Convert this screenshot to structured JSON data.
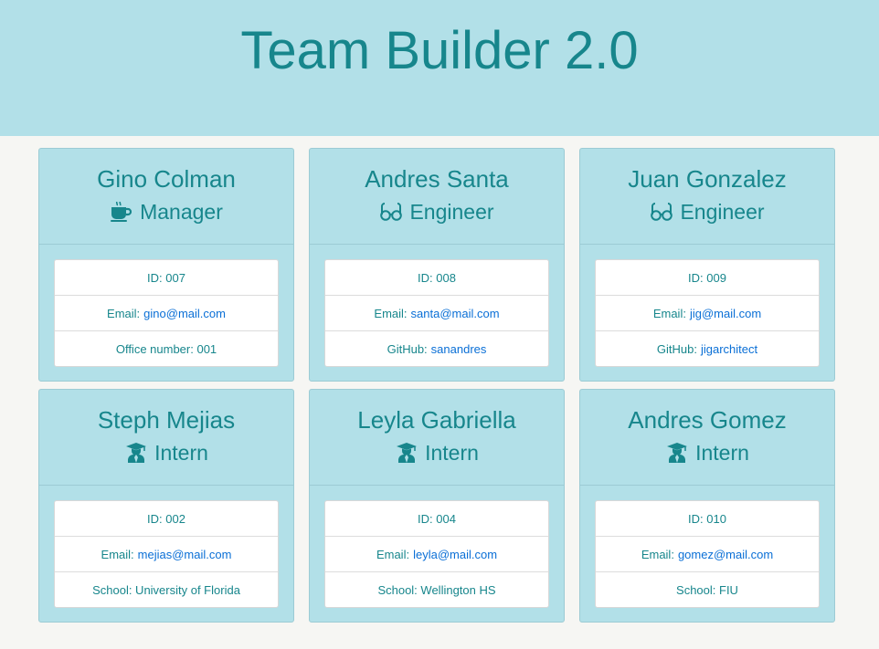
{
  "header": {
    "title": "Team Builder 2.0"
  },
  "team": [
    {
      "name": "Gino Colman",
      "role": "Manager",
      "role_icon": "coffee-mug-icon",
      "id_label": "ID: 007",
      "email_label": "Email:",
      "email": "gino@mail.com",
      "extra_label": "Office number: 001",
      "extra_link": ""
    },
    {
      "name": "Andres Santa",
      "role": "Engineer",
      "role_icon": "glasses-icon",
      "id_label": "ID: 008",
      "email_label": "Email:",
      "email": "santa@mail.com",
      "extra_label": "GitHub:",
      "extra_link": "sanandres"
    },
    {
      "name": "Juan Gonzalez",
      "role": "Engineer",
      "role_icon": "glasses-icon",
      "id_label": "ID: 009",
      "email_label": "Email:",
      "email": "jig@mail.com",
      "extra_label": "GitHub:",
      "extra_link": "jigarchitect"
    },
    {
      "name": "Steph Mejias",
      "role": "Intern",
      "role_icon": "graduate-icon",
      "id_label": "ID: 002",
      "email_label": "Email:",
      "email": "mejias@mail.com",
      "extra_label": "School: University of Florida",
      "extra_link": ""
    },
    {
      "name": "Leyla Gabriella",
      "role": "Intern",
      "role_icon": "graduate-icon",
      "id_label": "ID: 004",
      "email_label": "Email:",
      "email": "leyla@mail.com",
      "extra_label": "School: Wellington HS",
      "extra_link": ""
    },
    {
      "name": "Andres Gomez",
      "role": "Intern",
      "role_icon": "graduate-icon",
      "id_label": "ID: 010",
      "email_label": "Email:",
      "email": "gomez@mail.com",
      "extra_label": "School: FIU",
      "extra_link": ""
    }
  ],
  "colors": {
    "header_bg": "#b2e0e8",
    "text": "#17868c",
    "link": "#0a6fd6",
    "page_bg": "#f6f6f3"
  }
}
